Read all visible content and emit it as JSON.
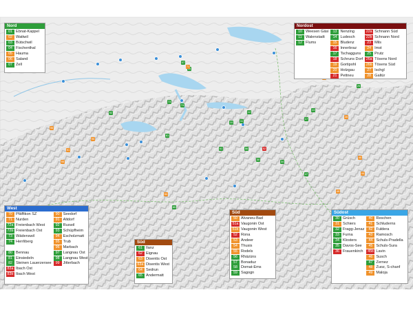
{
  "colors": {
    "green": "#2e9e3a",
    "orange": "#f0922b",
    "red": "#d62a2a",
    "blue_dot": "#3a8fd8",
    "nord_header": "#2e9e3a",
    "nordost_header": "#7a0f10",
    "west_header": "#2b6ccf",
    "sued_header": "#a24a10",
    "suedost_header": "#3aa6e6"
  },
  "legends": {
    "nord": {
      "title": "Nord",
      "columns": [
        [
          {
            "code": "01",
            "name": "Ebnat-Kappel",
            "color": "green"
          },
          {
            "code": "02",
            "name": "Wattwil",
            "color": "orange"
          },
          {
            "code": "03",
            "name": "Bütschwil",
            "color": "green"
          },
          {
            "code": "04",
            "name": "Fischenthal",
            "color": "green"
          },
          {
            "code": "05",
            "name": "Hauma",
            "color": "orange"
          },
          {
            "code": "06",
            "name": "Saland",
            "color": "orange"
          },
          {
            "code": "07",
            "name": "Zell",
            "color": "green"
          }
        ]
      ]
    },
    "nordost": {
      "title": "Nordost",
      "columns": [
        [
          {
            "code": "10",
            "name": "Weesen Gäsi",
            "color": "green"
          },
          {
            "code": "11",
            "name": "Walenstadt",
            "color": "green"
          },
          {
            "code": "12",
            "name": "Flums",
            "color": "green"
          }
        ],
        [
          {
            "code": "13",
            "name": "Nenzing",
            "color": "green"
          },
          {
            "code": "14",
            "name": "Ludesch",
            "color": "green"
          },
          {
            "code": "15",
            "name": "Bludenz",
            "color": "orange"
          },
          {
            "code": "16",
            "name": "Innerbraz",
            "color": "red"
          },
          {
            "code": "17",
            "name": "Tschagguns",
            "color": "green"
          },
          {
            "code": "18",
            "name": "Schruns Dorf",
            "color": "red"
          },
          {
            "code": "19",
            "name": "Gortipohl",
            "color": "orange"
          },
          {
            "code": "20",
            "name": "Holzgau",
            "color": "orange"
          },
          {
            "code": "21",
            "name": "Pettneu",
            "color": "red"
          }
        ],
        [
          {
            "code": "22a",
            "name": "Schnann Süd",
            "color": "red"
          },
          {
            "code": "22b",
            "name": "Schnann Nord",
            "color": "red"
          },
          {
            "code": "23",
            "name": "Mils",
            "color": "red"
          },
          {
            "code": "24",
            "name": "Imst",
            "color": "orange"
          },
          {
            "code": "25",
            "name": "Prutz",
            "color": "green"
          },
          {
            "code": "26a",
            "name": "Tösens Nord",
            "color": "red"
          },
          {
            "code": "26b",
            "name": "Tösens Süd",
            "color": "orange"
          },
          {
            "code": "27",
            "name": "Ischgl",
            "color": "orange"
          },
          {
            "code": "28",
            "name": "Galtür",
            "color": "orange"
          }
        ]
      ]
    },
    "west": {
      "title": "West",
      "columns": [
        [
          {
            "code": "70",
            "name": "Pfäffikon SZ",
            "color": "orange"
          },
          {
            "code": "71",
            "name": "Nurden",
            "color": "orange"
          },
          {
            "code": "72a",
            "name": "Freienbach West",
            "color": "green"
          },
          {
            "code": "72b",
            "name": "Freienbach Ost",
            "color": "green"
          },
          {
            "code": "73",
            "name": "Wädenswil",
            "color": "green"
          },
          {
            "code": "74",
            "name": "Herrliberg",
            "color": "green"
          },
          {
            "code": "",
            "name": "",
            "color": ""
          },
          {
            "code": "80",
            "name": "Bennau",
            "color": "green"
          },
          {
            "code": "81",
            "name": "Einsiedeln",
            "color": "green"
          },
          {
            "code": "82",
            "name": "Steinen Lauerzersee",
            "color": "green"
          },
          {
            "code": "83a",
            "name": "Ibach Ost",
            "color": "red"
          },
          {
            "code": "83b",
            "name": "Ibach West",
            "color": "red"
          }
        ],
        [
          {
            "code": "90",
            "name": "Seedorf",
            "color": "orange"
          },
          {
            "code": "91",
            "name": "Altdorf",
            "color": "orange"
          },
          {
            "code": "92",
            "name": "Ruswil",
            "color": "green"
          },
          {
            "code": "93",
            "name": "Schüpfheim",
            "color": "green"
          },
          {
            "code": "94",
            "name": "Escholzmatt",
            "color": "orange"
          },
          {
            "code": "95",
            "name": "Trub",
            "color": "orange"
          },
          {
            "code": "96",
            "name": "Marbach",
            "color": "orange"
          },
          {
            "code": "97",
            "name": "Langnau Ost",
            "color": "green"
          },
          {
            "code": "98",
            "name": "Langnau West",
            "color": "green"
          },
          {
            "code": "99",
            "name": "Jitterbach",
            "color": "red"
          }
        ]
      ]
    },
    "sued_small": {
      "title": "Süd",
      "columns": [
        [
          {
            "code": "61",
            "name": "Ilanz",
            "color": "green"
          },
          {
            "code": "62",
            "name": "Eignau",
            "color": "red"
          },
          {
            "code": "63",
            "name": "Disentis Ost",
            "color": "orange"
          },
          {
            "code": "63a",
            "name": "Disentis West",
            "color": "orange"
          },
          {
            "code": "64",
            "name": "Sedrun",
            "color": "orange"
          },
          {
            "code": "65",
            "name": "Andermatt",
            "color": "green"
          }
        ]
      ]
    },
    "sued": {
      "title": "Süd",
      "columns": [
        [
          {
            "code": "50",
            "name": "Alvaneu-Bad",
            "color": "orange"
          },
          {
            "code": "51a",
            "name": "Vaugonin Ost",
            "color": "red"
          },
          {
            "code": "51b",
            "name": "Vaugonin West",
            "color": "orange"
          },
          {
            "code": "52",
            "name": "Rona",
            "color": "red"
          },
          {
            "code": "53",
            "name": "Andeer",
            "color": "orange"
          },
          {
            "code": "54",
            "name": "Thusis",
            "color": "orange"
          },
          {
            "code": "55",
            "name": "Rodels",
            "color": "orange"
          },
          {
            "code": "56",
            "name": "Rhäzüns",
            "color": "green"
          },
          {
            "code": "57",
            "name": "Bonaduz",
            "color": "green"
          },
          {
            "code": "58",
            "name": "Domat-Ems",
            "color": "green"
          },
          {
            "code": "59",
            "name": "Sagogn",
            "color": "green"
          }
        ]
      ]
    },
    "suedost": {
      "title": "Südost",
      "columns": [
        [
          {
            "code": "30",
            "name": "Grüsch",
            "color": "green"
          },
          {
            "code": "31",
            "name": "Schiers",
            "color": "orange"
          },
          {
            "code": "32",
            "name": "Fragg-Jenaz",
            "color": "green"
          },
          {
            "code": "33",
            "name": "Furna",
            "color": "green"
          },
          {
            "code": "34",
            "name": "Klosters",
            "color": "green"
          },
          {
            "code": "35",
            "name": "Davos-See",
            "color": "green"
          },
          {
            "code": "36",
            "name": "Frauenkirch",
            "color": "red"
          }
        ],
        [
          {
            "code": "40",
            "name": "Reschen",
            "color": "orange"
          },
          {
            "code": "41",
            "name": "Schluderns",
            "color": "orange"
          },
          {
            "code": "42",
            "name": "Fuldera",
            "color": "orange"
          },
          {
            "code": "43",
            "name": "Ramosch",
            "color": "orange"
          },
          {
            "code": "44",
            "name": "Schuls-Pradella",
            "color": "orange"
          },
          {
            "code": "45",
            "name": "Schuls-Sura",
            "color": "orange"
          },
          {
            "code": "45b",
            "name": "Lavin",
            "color": "red"
          },
          {
            "code": "46",
            "name": "Susch",
            "color": "orange"
          },
          {
            "code": "47",
            "name": "Zernez",
            "color": "green"
          },
          {
            "code": "48",
            "name": "Zuoz, S-chanf",
            "color": "orange"
          },
          {
            "code": "49",
            "name": "Maloja",
            "color": "orange"
          }
        ]
      ]
    }
  },
  "map_markers": [
    {
      "code": "07",
      "color": "green"
    },
    {
      "code": "04",
      "color": "green"
    },
    {
      "code": "73",
      "color": "green"
    },
    {
      "code": "74",
      "color": "green"
    },
    {
      "code": "71",
      "color": "orange"
    },
    {
      "code": "81",
      "color": "green"
    },
    {
      "code": "12",
      "color": "green"
    },
    {
      "code": "11",
      "color": "green"
    },
    {
      "code": "10",
      "color": "green"
    },
    {
      "code": "13",
      "color": "green"
    },
    {
      "code": "17",
      "color": "green"
    },
    {
      "code": "24",
      "color": "orange"
    },
    {
      "code": "92",
      "color": "green"
    },
    {
      "code": "90",
      "color": "orange"
    },
    {
      "code": "91",
      "color": "orange"
    },
    {
      "code": "61",
      "color": "green"
    },
    {
      "code": "56",
      "color": "green"
    },
    {
      "code": "52",
      "color": "red"
    },
    {
      "code": "30",
      "color": "green"
    },
    {
      "code": "34",
      "color": "green"
    },
    {
      "code": "40",
      "color": "orange"
    },
    {
      "code": "44",
      "color": "orange"
    },
    {
      "code": "47",
      "color": "green"
    },
    {
      "code": "49",
      "color": "orange"
    },
    {
      "code": "64",
      "color": "orange"
    },
    {
      "code": "65",
      "color": "green"
    },
    {
      "code": "96",
      "color": "orange"
    },
    {
      "code": "95",
      "color": "orange"
    },
    {
      "code": "25",
      "color": "green"
    },
    {
      "code": "28",
      "color": "orange"
    }
  ]
}
